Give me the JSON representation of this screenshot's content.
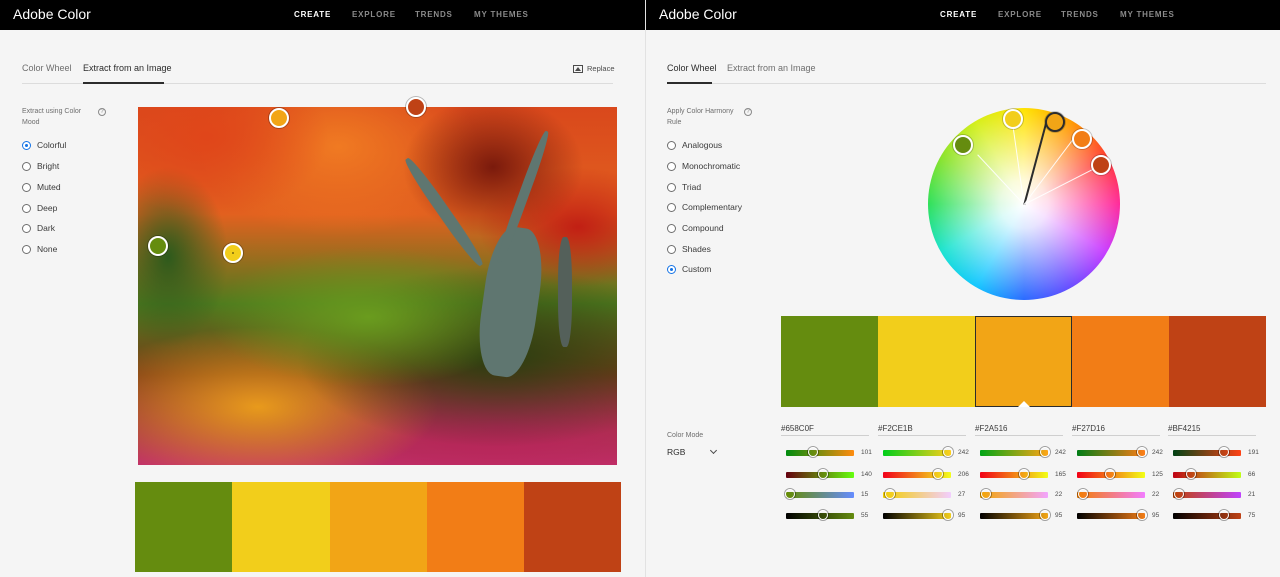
{
  "left": {
    "brand": "Adobe Color",
    "nav": [
      "CREATE",
      "EXPLORE",
      "TRENDS",
      "MY THEMES"
    ],
    "tabs": [
      "Color Wheel",
      "Extract from an Image"
    ],
    "replace_label": "Replace",
    "mood_label": "Extract using Color Mood",
    "moods": [
      {
        "label": "Colorful",
        "checked": true
      },
      {
        "label": "Bright",
        "checked": false
      },
      {
        "label": "Muted",
        "checked": false
      },
      {
        "label": "Deep",
        "checked": false
      },
      {
        "label": "Dark",
        "checked": false
      },
      {
        "label": "None",
        "checked": false
      }
    ]
  },
  "right": {
    "brand": "Adobe Color",
    "nav": [
      "CREATE",
      "EXPLORE",
      "TRENDS",
      "MY THEMES"
    ],
    "tabs": [
      "Color Wheel",
      "Extract from an Image"
    ],
    "harmony_label": "Apply Color Harmony Rule",
    "rules": [
      {
        "label": "Analogous",
        "checked": false
      },
      {
        "label": "Monochromatic",
        "checked": false
      },
      {
        "label": "Triad",
        "checked": false
      },
      {
        "label": "Complementary",
        "checked": false
      },
      {
        "label": "Compound",
        "checked": false
      },
      {
        "label": "Shades",
        "checked": false
      },
      {
        "label": "Custom",
        "checked": true
      }
    ],
    "color_mode_label": "Color Mode",
    "color_mode_value": "RGB"
  },
  "swatches": [
    {
      "hex_label": "#658C0F",
      "color": "#658C0F",
      "rgb": [
        101,
        140,
        15
      ],
      "brightness": 55
    },
    {
      "hex_label": "#F2CE1B",
      "color": "#F2CE1B",
      "rgb": [
        242,
        206,
        27
      ],
      "brightness": 95
    },
    {
      "hex_label": "#F2A516",
      "color": "#F2A516",
      "rgb": [
        242,
        165,
        22
      ],
      "brightness": 95,
      "selected": true
    },
    {
      "hex_label": "#F27D16",
      "color": "#F27D16",
      "rgb": [
        242,
        125,
        22
      ],
      "brightness": 95
    },
    {
      "hex_label": "#BF4215",
      "color": "#BF4215",
      "rgb": [
        191,
        66,
        21
      ],
      "brightness": 75
    }
  ]
}
